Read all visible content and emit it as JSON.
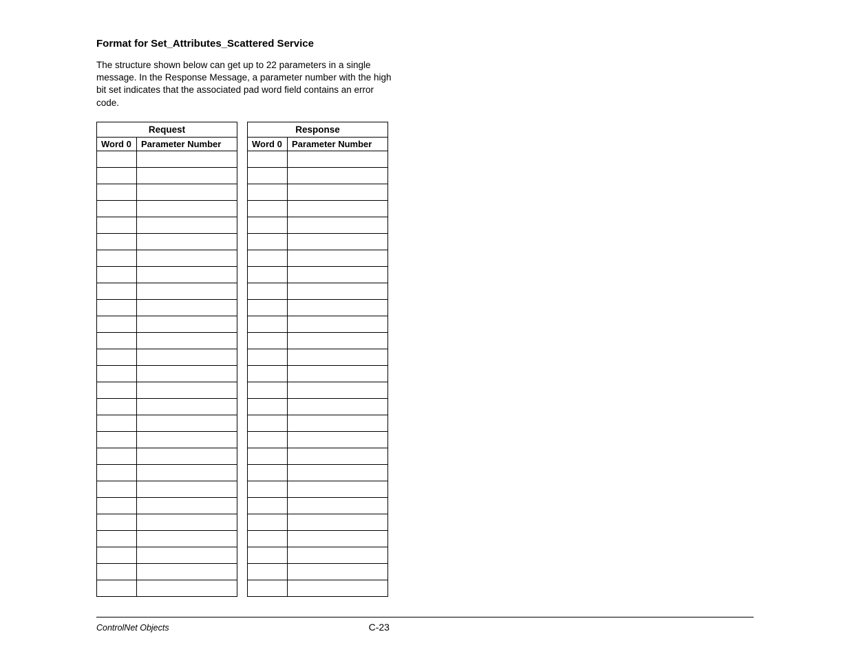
{
  "heading": "Format for Set_Attributes_Scattered Service",
  "body_text": "The structure shown below can get up to 22 parameters in a single message.  In the Response Message, a parameter number with the high bit set indicates that the associated pad word field contains an error code.",
  "tables": {
    "request": {
      "title": "Request",
      "col1": "Word 0",
      "col2": "Parameter Number",
      "row_count": 27
    },
    "response": {
      "title": "Response",
      "col1": "Word 0",
      "col2": "Parameter Number",
      "row_count": 27
    }
  },
  "footer": {
    "left": "ControlNet Objects",
    "right": "C-23"
  }
}
